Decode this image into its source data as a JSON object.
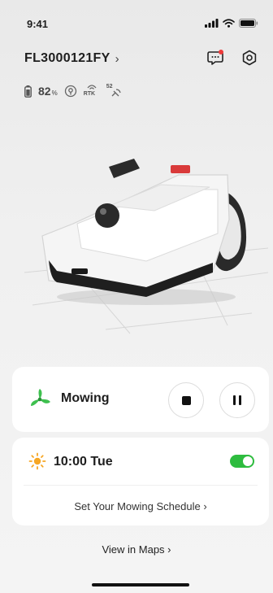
{
  "status_bar": {
    "time": "9:41"
  },
  "device": {
    "name": "FL3000121FY",
    "chevron": "›"
  },
  "stats": {
    "battery_value": "82",
    "battery_unit": "%",
    "rtk_label": "RTK",
    "signal_label": "52"
  },
  "mowing": {
    "status": "Mowing"
  },
  "schedule": {
    "time": "10:00 Tue",
    "enabled": true,
    "link": "Set Your Mowing Schedule ›"
  },
  "maps": {
    "link": "View in Maps ›"
  },
  "colors": {
    "accent_green": "#2ebc3f",
    "notification": "#ee3b3b",
    "sun": "#f6a623"
  }
}
